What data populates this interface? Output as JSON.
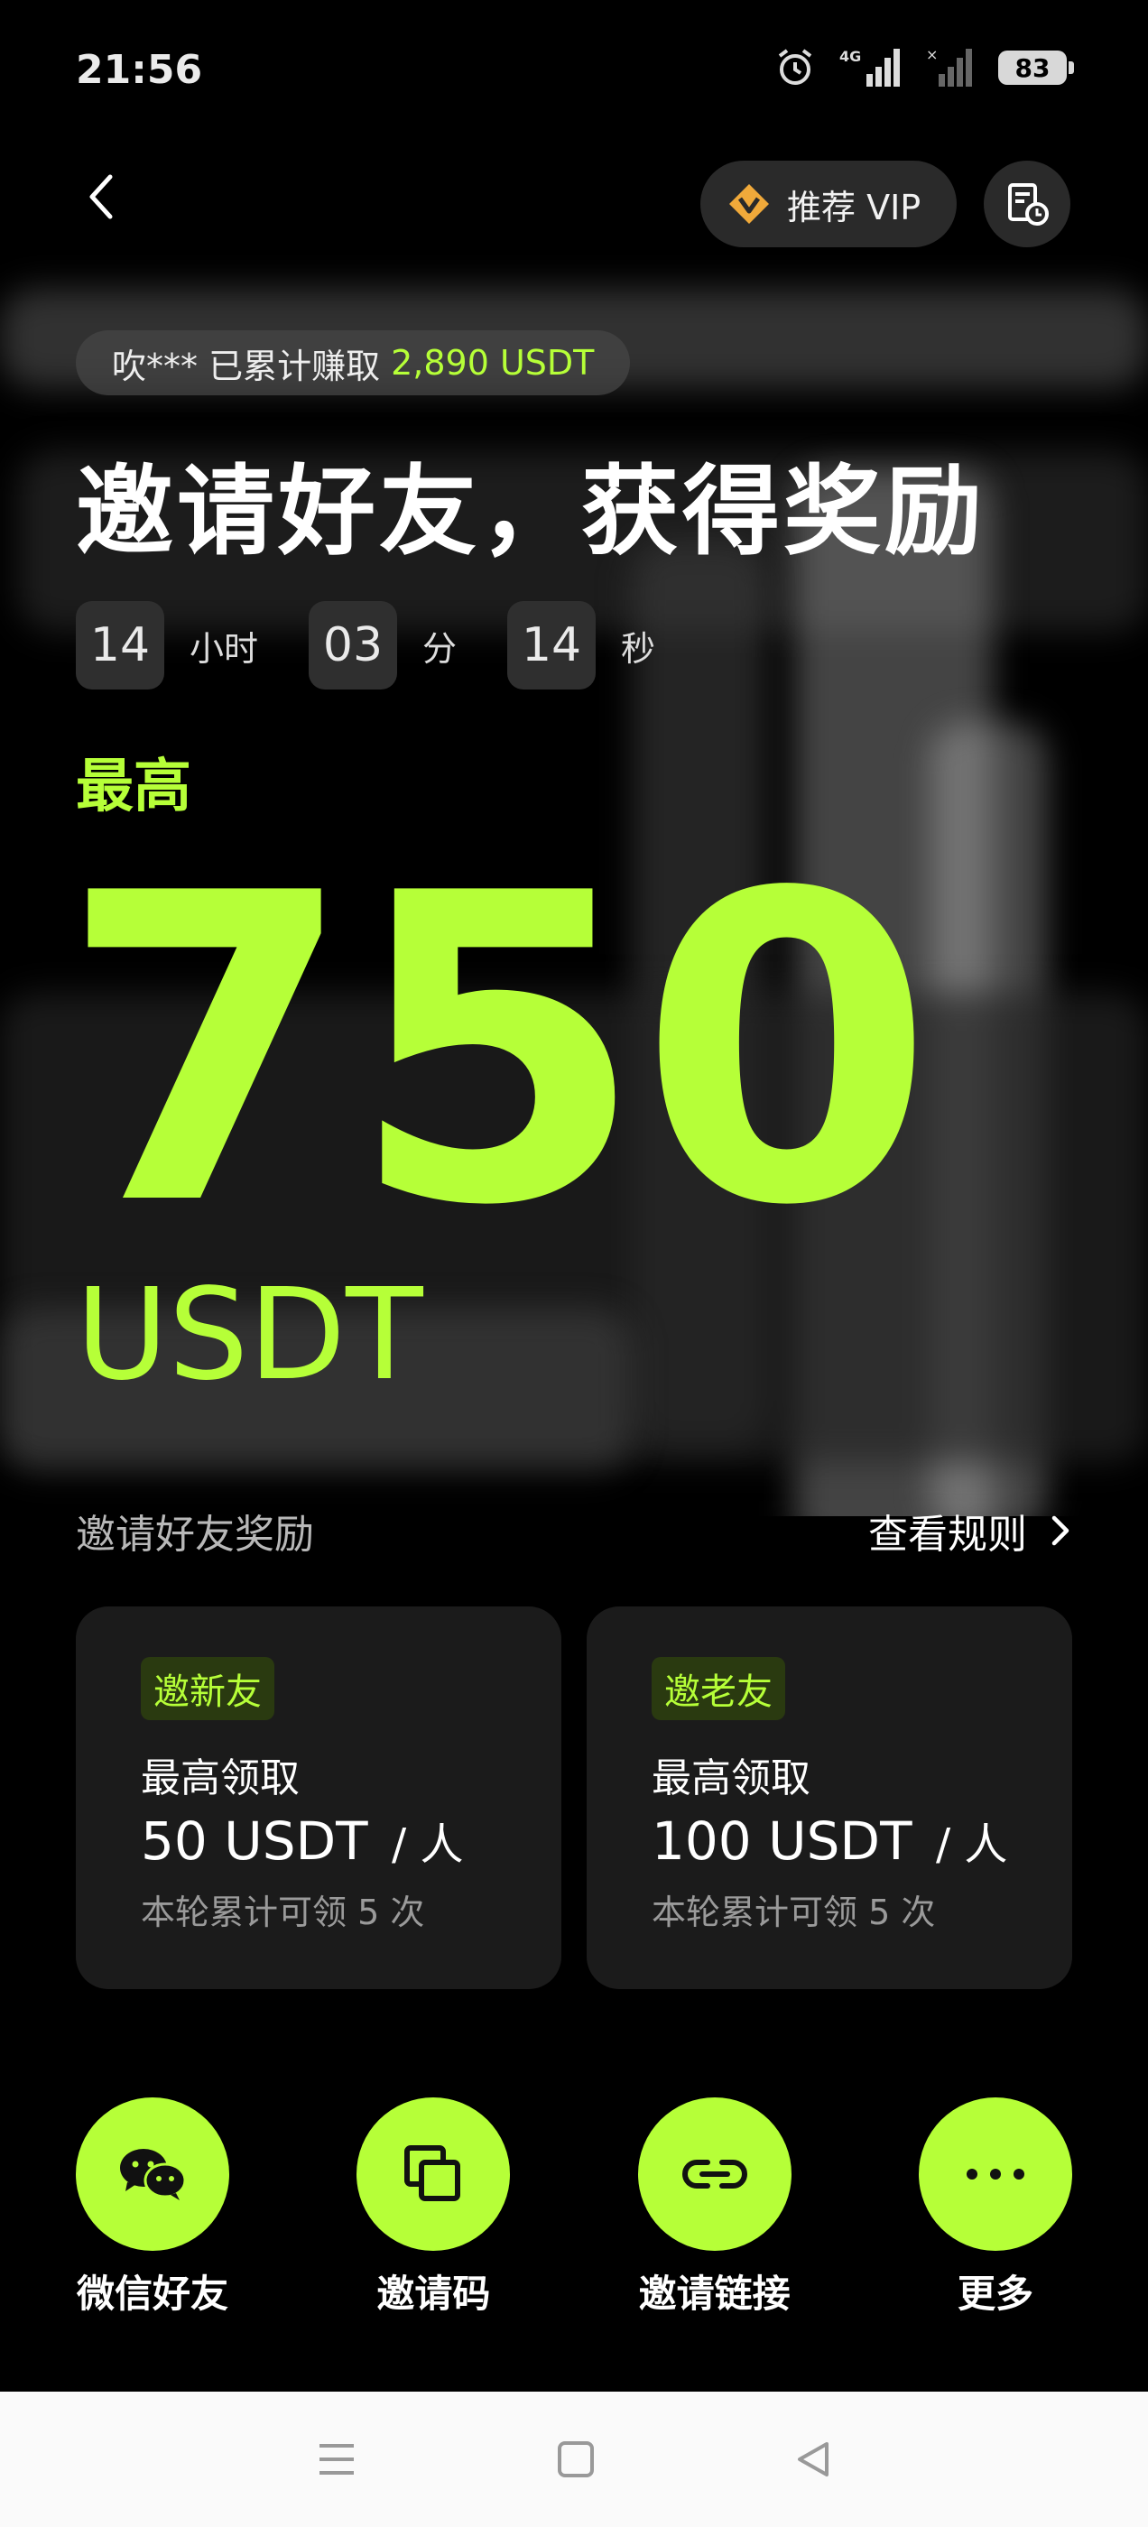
{
  "status_bar": {
    "time": "21:56",
    "network": "4G",
    "battery": "83"
  },
  "header": {
    "vip_label": "推荐 VIP"
  },
  "earn": {
    "prefix": "吹*** 已累计赚取",
    "amount": "2,890 USDT"
  },
  "headline": "邀请好友，获得奖励",
  "countdown": {
    "hours": "14",
    "hours_unit": "小时",
    "minutes": "03",
    "minutes_unit": "分",
    "seconds": "14",
    "seconds_unit": "秒"
  },
  "reward": {
    "max_label": "最高",
    "value": "750",
    "unit": "USDT"
  },
  "section": {
    "title": "邀请好友奖励",
    "rules_label": "查看规则"
  },
  "cards": [
    {
      "tag": "邀新友",
      "line1": "最高领取",
      "amount": "50 USDT",
      "per": "/ 人",
      "note": "本轮累计可领 5 次"
    },
    {
      "tag": "邀老友",
      "line1": "最高领取",
      "amount": "100 USDT",
      "per": "/ 人",
      "note": "本轮累计可领 5 次"
    }
  ],
  "share": [
    {
      "label": "微信好友",
      "icon": "wechat-icon"
    },
    {
      "label": "邀请码",
      "icon": "copy-icon"
    },
    {
      "label": "邀请链接",
      "icon": "link-icon"
    },
    {
      "label": "更多",
      "icon": "more-icon"
    }
  ],
  "colors": {
    "accent": "#b6ff38",
    "background": "#000000",
    "card": "#1b1b1b"
  }
}
